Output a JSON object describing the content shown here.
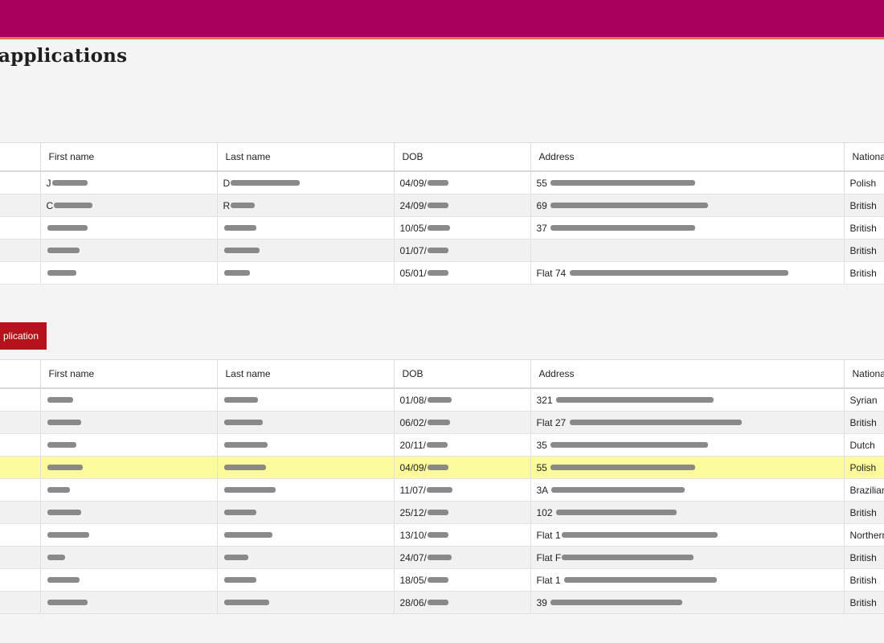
{
  "page": {
    "title": "applications"
  },
  "colors": {
    "header_bar": "#a8005b",
    "header_accent": "#e8734a",
    "button": "#b5121b",
    "highlight_row": "#fbfb9b"
  },
  "columns": [
    "First name",
    "Last name",
    "DOB",
    "Address",
    "Nationa"
  ],
  "new_application_button": {
    "label": "plication"
  },
  "table_one": {
    "rows": [
      {
        "first_prefix": "J",
        "first_redact": 44,
        "last_prefix": "D",
        "last_redact": 86,
        "dob": "04/09/",
        "dob_redact": 26,
        "addr": "55 ",
        "addr_redact": 180,
        "nationality": "Polish"
      },
      {
        "first_prefix": "C",
        "first_redact": 48,
        "last_prefix": "R",
        "last_redact": 30,
        "dob": "24/09/",
        "dob_redact": 26,
        "addr": "69 ",
        "addr_redact": 196,
        "nationality": "British"
      },
      {
        "first_prefix": "",
        "first_redact": 50,
        "last_prefix": "",
        "last_redact": 40,
        "dob": "10/05/",
        "dob_redact": 28,
        "addr": "37 ",
        "addr_redact": 180,
        "nationality": "British"
      },
      {
        "first_prefix": "",
        "first_redact": 40,
        "last_prefix": "",
        "last_redact": 44,
        "dob": "01/07/",
        "dob_redact": 26,
        "addr": "",
        "addr_redact": 0,
        "nationality": "British"
      },
      {
        "first_prefix": "",
        "first_redact": 36,
        "last_prefix": "",
        "last_redact": 32,
        "dob": "05/01/",
        "dob_redact": 26,
        "addr": "Flat 74 ",
        "addr_redact": 272,
        "nationality": "British"
      }
    ]
  },
  "table_two": {
    "rows": [
      {
        "first_prefix": "",
        "first_redact": 32,
        "last_prefix": "",
        "last_redact": 42,
        "dob": "01/08/",
        "dob_redact": 30,
        "addr": "321 ",
        "addr_redact": 196,
        "nationality": "Syrian"
      },
      {
        "first_prefix": "",
        "first_redact": 42,
        "last_prefix": "",
        "last_redact": 48,
        "dob": "06/02/",
        "dob_redact": 28,
        "addr": "Flat 27 ",
        "addr_redact": 214,
        "nationality": "British"
      },
      {
        "first_prefix": "",
        "first_redact": 36,
        "last_prefix": "",
        "last_redact": 54,
        "dob": "20/11/",
        "dob_redact": 26,
        "addr": "35 ",
        "addr_redact": 196,
        "nationality": "Dutch"
      },
      {
        "first_prefix": "",
        "first_redact": 44,
        "last_prefix": "",
        "last_redact": 52,
        "dob": "04/09/",
        "dob_redact": 26,
        "addr": "55 ",
        "addr_redact": 180,
        "nationality": "Polish"
      },
      {
        "first_prefix": "",
        "first_redact": 28,
        "last_prefix": "",
        "last_redact": 64,
        "dob": "11/07/",
        "dob_redact": 32,
        "addr": "3A ",
        "addr_redact": 166,
        "nationality": "Brazilian"
      },
      {
        "first_prefix": "",
        "first_redact": 42,
        "last_prefix": "",
        "last_redact": 40,
        "dob": "25/12/",
        "dob_redact": 26,
        "addr": "102 ",
        "addr_redact": 150,
        "nationality": "British"
      },
      {
        "first_prefix": "",
        "first_redact": 52,
        "last_prefix": "",
        "last_redact": 60,
        "dob": "13/10/",
        "dob_redact": 26,
        "addr": "Flat 1",
        "addr_redact": 194,
        "nationality": "Northern"
      },
      {
        "first_prefix": "",
        "first_redact": 22,
        "last_prefix": "",
        "last_redact": 30,
        "dob": "24/07/",
        "dob_redact": 30,
        "addr": "Flat F",
        "addr_redact": 164,
        "nationality": "British"
      },
      {
        "first_prefix": "",
        "first_redact": 40,
        "last_prefix": "",
        "last_redact": 40,
        "dob": "18/05/",
        "dob_redact": 26,
        "addr": "Flat 1 ",
        "addr_redact": 190,
        "nationality": "British"
      },
      {
        "first_prefix": "",
        "first_redact": 50,
        "last_prefix": "",
        "last_redact": 56,
        "dob": "28/06/",
        "dob_redact": 26,
        "addr": "39 ",
        "addr_redact": 164,
        "nationality": "British"
      }
    ],
    "highlighted_row_index": 3
  }
}
